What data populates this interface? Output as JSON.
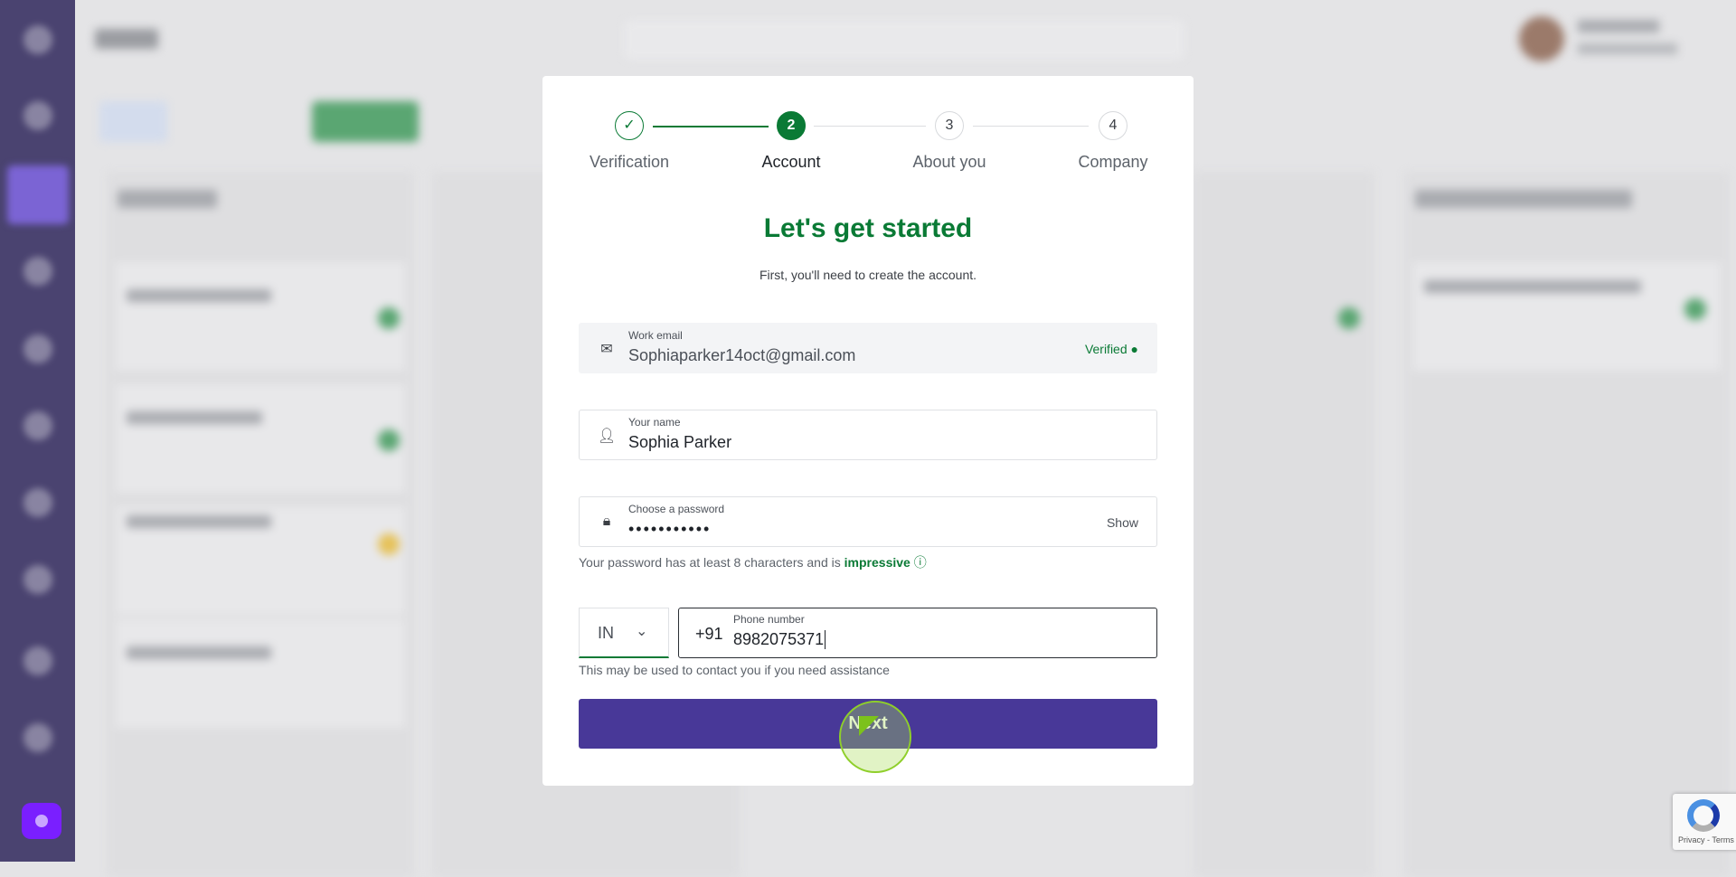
{
  "stepper": {
    "steps": [
      {
        "number": "",
        "label": "Verification",
        "state": "done"
      },
      {
        "number": "2",
        "label": "Account",
        "state": "current"
      },
      {
        "number": "3",
        "label": "About you",
        "state": "upcoming"
      },
      {
        "number": "4",
        "label": "Company",
        "state": "upcoming"
      }
    ]
  },
  "form": {
    "title": "Let's get started",
    "subtitle": "First, you'll need to create the account.",
    "email": {
      "label": "Work email",
      "value": "Sophiaparker14oct@gmail.com",
      "status": "Verified",
      "icon": "mail-icon"
    },
    "name": {
      "label": "Your name",
      "value": "Sophia Parker",
      "icon": "user-icon"
    },
    "password": {
      "label": "Choose a password",
      "value": "•••••••••••",
      "toggle": "Show",
      "icon": "lock-icon",
      "hint_prefix": "Your password has at least 8 characters and is",
      "hint_strength": "impressive"
    },
    "phone": {
      "country": "IN",
      "code": "+91",
      "label": "Phone number",
      "value": "8982075371",
      "hint": "This may be used to contact you if you need assistance"
    },
    "next_label": "Next"
  },
  "recaptcha": {
    "links": "Privacy - Terms"
  },
  "colors": {
    "accent": "#0a7a35",
    "button": "#483898",
    "sidebar": "#4a4370"
  }
}
